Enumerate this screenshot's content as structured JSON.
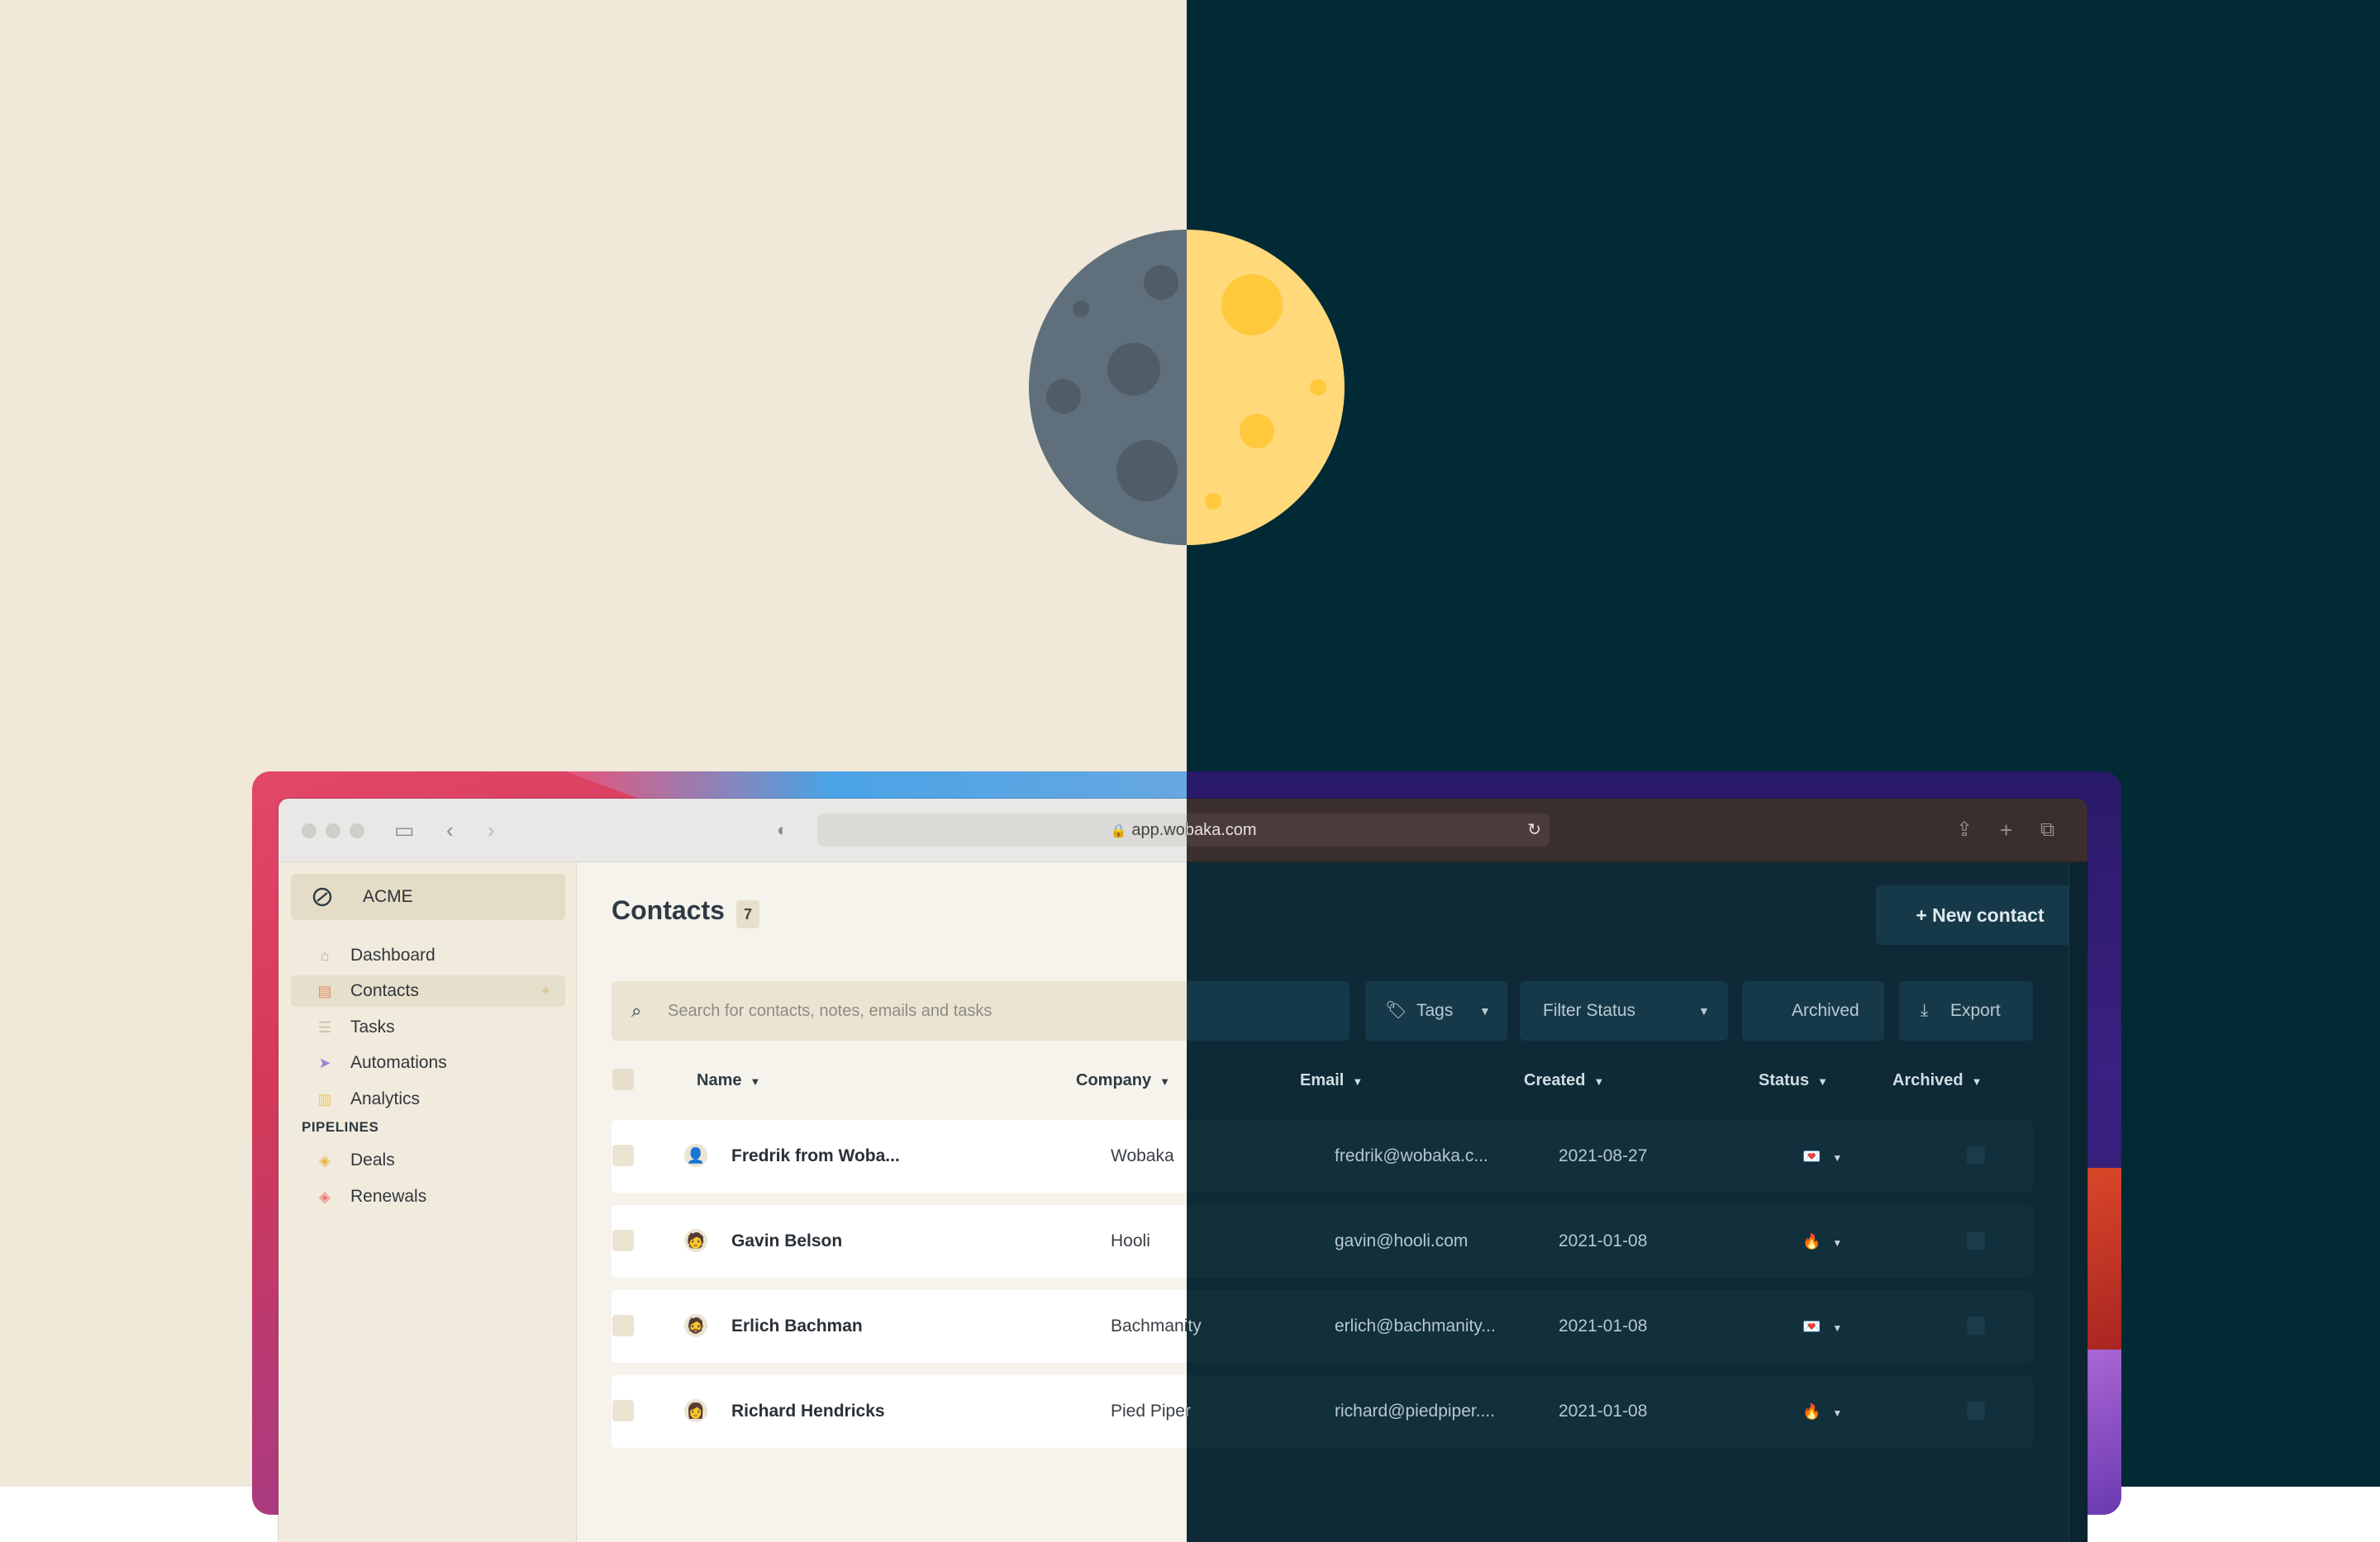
{
  "browser": {
    "url": "app.wobaka.com"
  },
  "sidebar": {
    "org_name": "ACME",
    "items": [
      {
        "label": "Dashboard",
        "icon": "home-icon"
      },
      {
        "label": "Contacts",
        "icon": "contact-card-icon"
      },
      {
        "label": "Tasks",
        "icon": "checklist-icon"
      },
      {
        "label": "Automations",
        "icon": "paper-plane-icon"
      },
      {
        "label": "Analytics",
        "icon": "bar-chart-icon"
      }
    ],
    "section_label": "PIPELINES",
    "pipelines": [
      {
        "label": "Deals",
        "icon": "stack-icon"
      },
      {
        "label": "Renewals",
        "icon": "stack-icon"
      }
    ]
  },
  "main": {
    "title": "Contacts",
    "count": "7",
    "new_button": "New contact",
    "search_placeholder": "Search for contacts, notes, emails and tasks",
    "filters": {
      "tags": "Tags",
      "status": "Filter Status",
      "archived": "Archived",
      "export": "Export"
    },
    "columns": {
      "name": "Name",
      "company": "Company",
      "email": "Email",
      "created": "Created",
      "status": "Status",
      "archived": "Archived"
    },
    "rows": [
      {
        "name": "Fredrik from Woba...",
        "company": "Wobaka",
        "email": "fredrik@wobaka.c...",
        "created": "2021-08-27",
        "status_icon": "💌"
      },
      {
        "name": "Gavin Belson",
        "company": "Hooli",
        "email": "gavin@hooli.com",
        "created": "2021-01-08",
        "status_icon": "🔥"
      },
      {
        "name": "Erlich Bachman",
        "company": "Bachmanity",
        "email": "erlich@bachmanity...",
        "created": "2021-01-08",
        "status_icon": "💌"
      },
      {
        "name": "Richard Hendricks",
        "company": "Pied Piper",
        "email": "richard@piedpiper....",
        "created": "2021-01-08",
        "status_icon": "🔥"
      }
    ]
  },
  "colors": {
    "light_bg": "#f0e8d8",
    "dark_bg": "#012a34",
    "moon_dark": "#5f6f7b",
    "moon_light": "#ffd97a"
  }
}
